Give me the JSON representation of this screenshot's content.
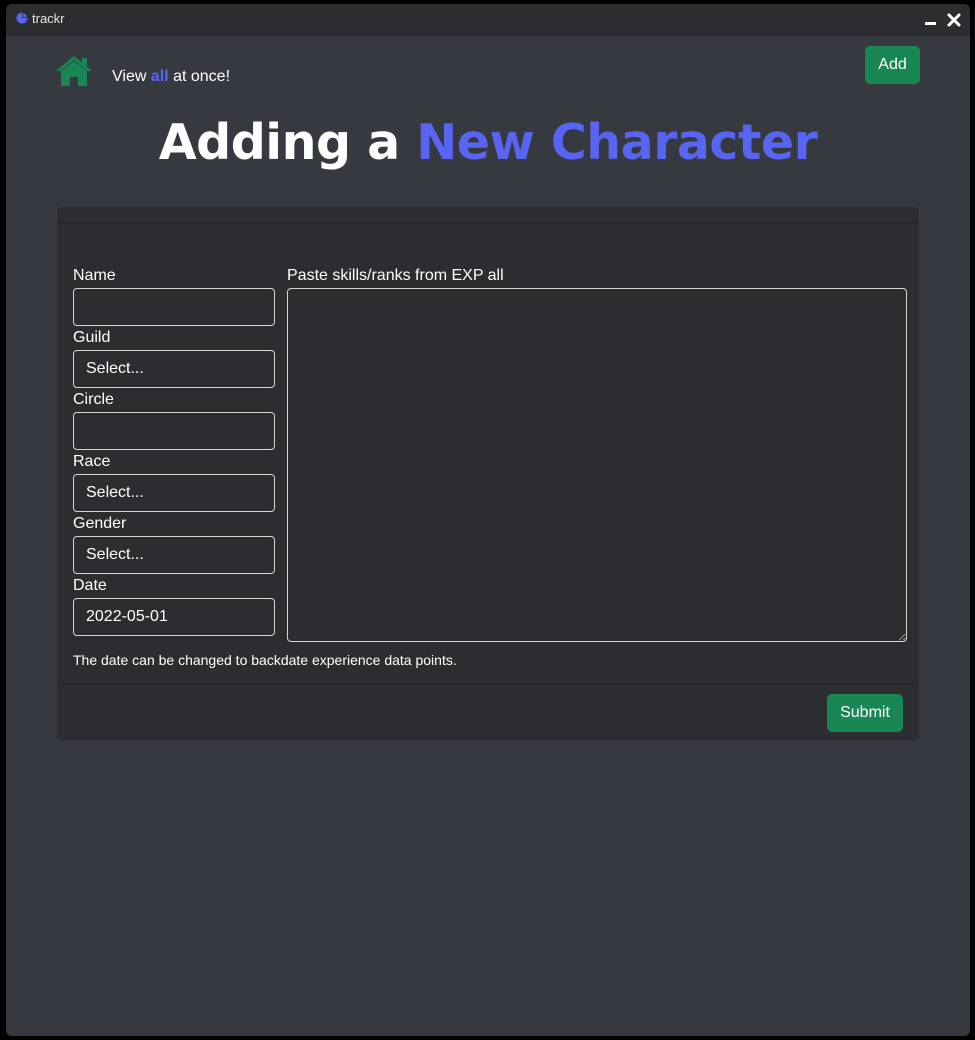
{
  "window": {
    "title": "trackr",
    "icons": {
      "app": "pie-chart-icon",
      "minimize": "minimize-icon",
      "close": "close-icon"
    }
  },
  "header": {
    "home_icon": "home-icon",
    "tagline_before": "View ",
    "tagline_accent": "all",
    "tagline_after": " at once!",
    "add_label": "Add"
  },
  "page": {
    "title_plain": "Adding a ",
    "title_accent": "New Character"
  },
  "form": {
    "name": {
      "label": "Name",
      "value": ""
    },
    "guild": {
      "label": "Guild",
      "value": "Select..."
    },
    "circle": {
      "label": "Circle",
      "value": ""
    },
    "race": {
      "label": "Race",
      "value": "Select..."
    },
    "gender": {
      "label": "Gender",
      "value": "Select..."
    },
    "date": {
      "label": "Date",
      "value": "2022-05-01"
    },
    "skills": {
      "label": "Paste skills/ranks from EXP all",
      "value": ""
    },
    "help_text": "The date can be changed to backdate experience data points.",
    "submit_label": "Submit"
  },
  "colors": {
    "accent": "#5865f2",
    "success": "#198754",
    "background": "#363940",
    "card": "#2b2d31"
  }
}
